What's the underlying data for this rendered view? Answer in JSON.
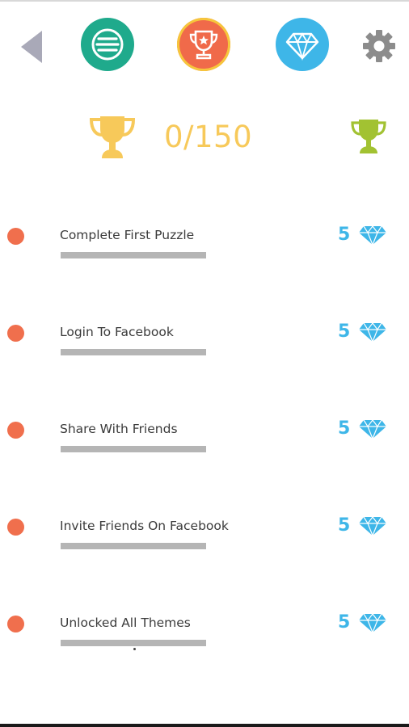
{
  "nav": {
    "back_icon": "back-arrow-icon",
    "menu_icon": "menu-lines-icon",
    "trophy_icon": "trophy-icon",
    "gems_icon": "diamond-icon",
    "settings_icon": "gear-icon"
  },
  "colors": {
    "menu": "#1faa8c",
    "trophy_active": "#f06a4a",
    "trophy_ring": "#f6c63c",
    "gems": "#3eb6e8",
    "gold": "#f7c95a",
    "lime": "#a2c232",
    "dot": "#f06f4d",
    "gear": "#8c8c8c",
    "back": "#a9a9b8"
  },
  "header": {
    "progress": "0/150"
  },
  "achievements": [
    {
      "title": "Complete First Puzzle",
      "reward": "5",
      "progress": 0
    },
    {
      "title": "Login To Facebook",
      "reward": "5",
      "progress": 0
    },
    {
      "title": "Share With Friends",
      "reward": "5",
      "progress": 0
    },
    {
      "title": "Invite Friends On Facebook",
      "reward": "5",
      "progress": 0
    },
    {
      "title": "Unlocked All Themes",
      "reward": "5",
      "progress": 0
    }
  ]
}
